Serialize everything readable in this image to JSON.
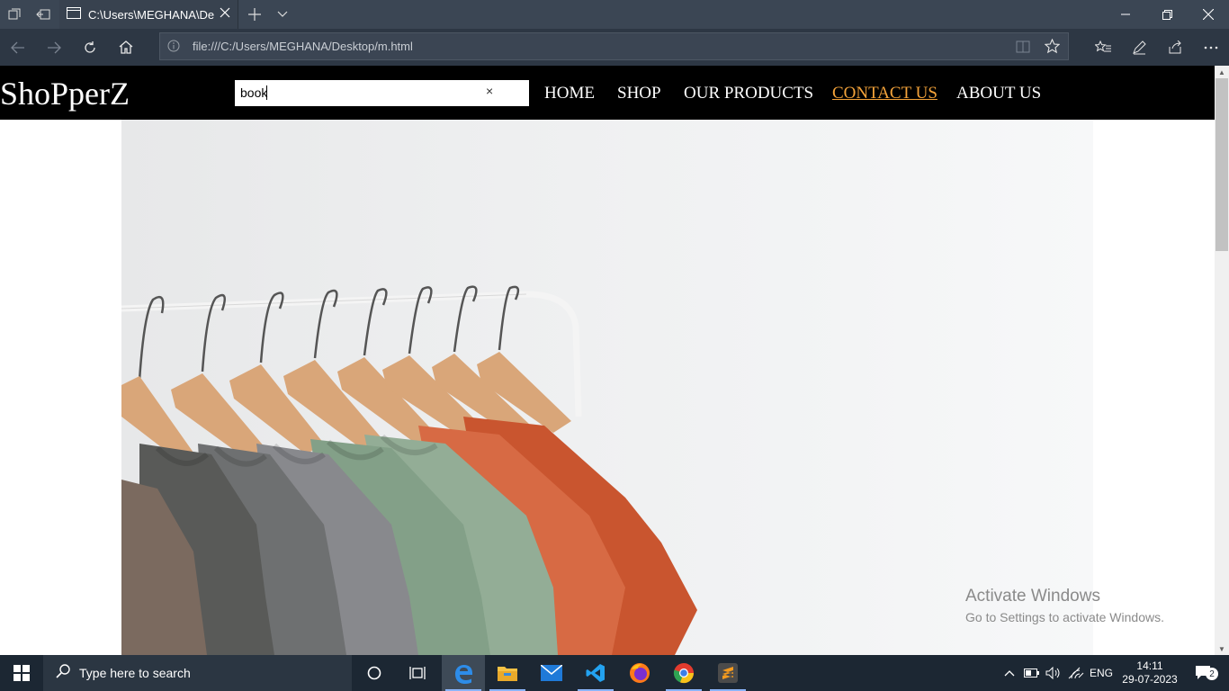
{
  "browser": {
    "tab_title": "C:\\Users\\MEGHANA\\De",
    "url": "file:///C:/Users/MEGHANA/Desktop/m.html"
  },
  "site": {
    "logo": "ShoPperZ",
    "search_value": "book",
    "search_clear": "×",
    "nav": {
      "home": "HOME",
      "shop": "SHOP",
      "products": "OUR PRODUCTS",
      "contact": "CONTACT US",
      "about": "ABOUT US"
    },
    "accent_color": "#f4a33a"
  },
  "watermark": {
    "line1": "Activate Windows",
    "line2": "Go to Settings to activate Windows."
  },
  "taskbar": {
    "search_placeholder": "Type here to search",
    "language": "ENG",
    "time": "14:11",
    "date": "29-07-2023",
    "notification_count": "2"
  }
}
